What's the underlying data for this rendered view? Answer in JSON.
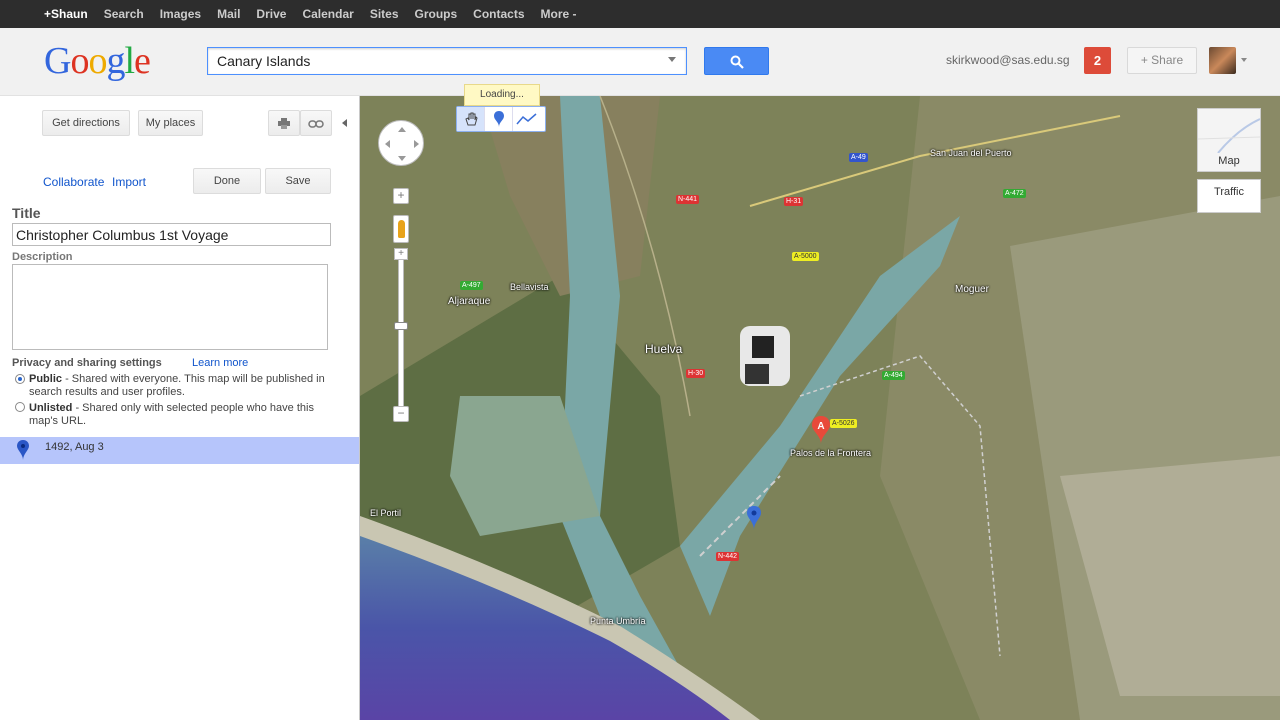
{
  "topbar": {
    "items": [
      "+Shaun",
      "Search",
      "Images",
      "Mail",
      "Drive",
      "Calendar",
      "Sites",
      "Groups",
      "Contacts",
      "More -"
    ]
  },
  "header": {
    "logo": [
      "G",
      "o",
      "o",
      "g",
      "l",
      "e"
    ],
    "search_value": "Canary Islands",
    "user_email": "skirkwood@sas.edu.sg",
    "notification_count": "2",
    "share_label": "+ Share"
  },
  "panel": {
    "get_directions": "Get directions",
    "my_places": "My places",
    "collaborate": "Collaborate",
    "import": "Import",
    "done": "Done",
    "save": "Save",
    "title_label": "Title",
    "title_value": "Christopher Columbus 1st Voyage",
    "description_label": "Description",
    "privacy_label": "Privacy and sharing settings",
    "learn_more": "Learn more",
    "public_bold": "Public",
    "public_text": " - Shared with everyone. This map will be published in search results and user profiles.",
    "unlisted_bold": "Unlisted",
    "unlisted_text": " - Shared only with selected people who have this map's URL.",
    "placemark": "1492, Aug 3"
  },
  "map": {
    "loading": "Loading...",
    "map_type": "Map",
    "traffic": "Traffic",
    "labels": [
      "Huelva",
      "Moguer",
      "Aljaraque",
      "Punta Umbría",
      "Palos de la Frontera",
      "El Portil",
      "Bellavista",
      "San Juan del Puerto"
    ],
    "roads": [
      "N-441",
      "A-497",
      "H-31",
      "A-5000",
      "N-442",
      "A-494",
      "H-30",
      "A-5026",
      "A-472",
      "A-49"
    ]
  },
  "colors": {
    "accent": "#4a8af4",
    "badge": "#dd4b39",
    "selected_row": "#b6c5fb",
    "link": "#1155cc"
  }
}
